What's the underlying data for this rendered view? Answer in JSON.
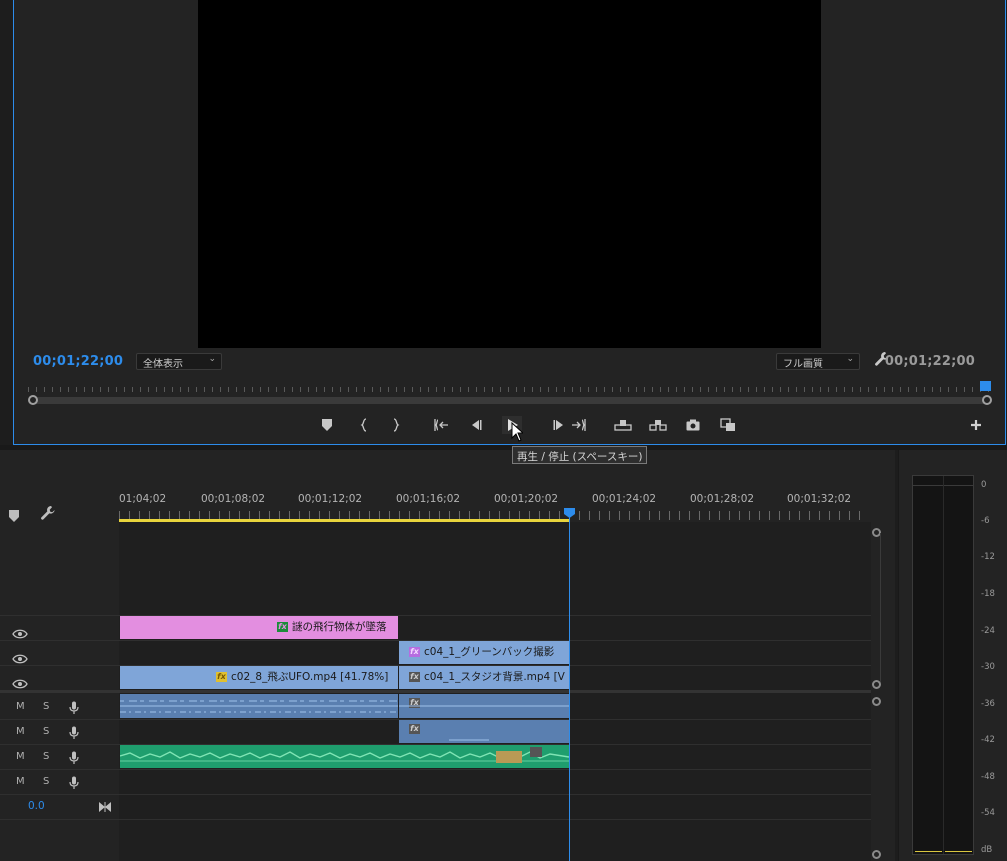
{
  "monitor": {
    "timecode_current": "00;01;22;00",
    "timecode_duration": "00;01;22;00",
    "fit_dropdown": "全体表示",
    "quality_dropdown": "フル画質",
    "tooltip": "再生 / 停止 (スペースキー)"
  },
  "timeline": {
    "ruler": [
      "01;04;02",
      "00;01;08;02",
      "00;01;12;02",
      "00;01;16;02",
      "00;01;20;02",
      "00;01;24;02",
      "00;01;28;02",
      "00;01;32;02"
    ],
    "clips": {
      "v3_title": "謎の飛行物体が墜落",
      "v2_green": "c04_1_グリーンバック撮影",
      "v1_ufo": "c02_8_飛ぶUFO.mp4 [41.78%]",
      "v1_studio": "c04_1_スタジオ背景.mp4 [V"
    },
    "audio_buttons": {
      "mute": "M",
      "solo": "S"
    },
    "master_volume": "0.0"
  },
  "meter": {
    "db_labels": [
      "0",
      "-6",
      "-12",
      "-18",
      "-24",
      "-30",
      "-36",
      "-42",
      "-48",
      "-54",
      "dB"
    ]
  },
  "colors": {
    "accent": "#2d8ceb",
    "title_clip": "#e38ee0",
    "video_clip": "#7fa5d8",
    "audio_clip": "#1f9e6e",
    "workarea": "#e8d43c"
  }
}
